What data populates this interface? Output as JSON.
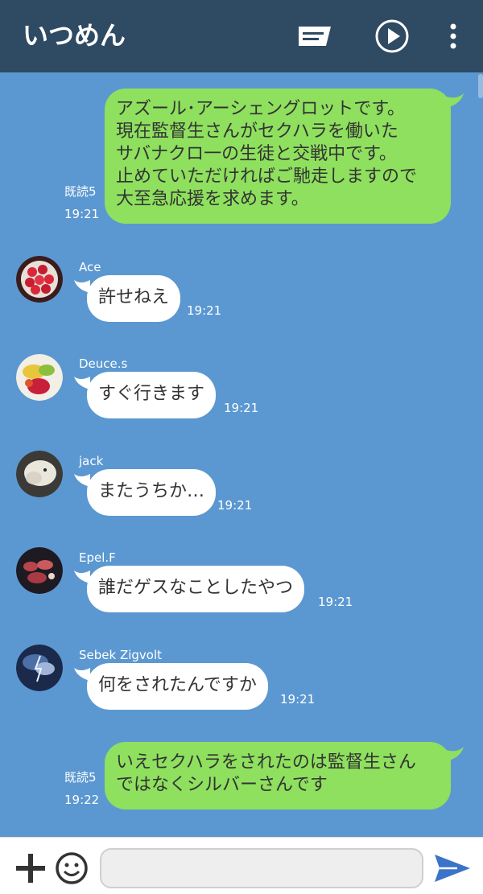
{
  "header": {
    "title": "いつめん",
    "icons": [
      "note-icon",
      "play-icon",
      "more-vert-icon"
    ],
    "colors": {
      "bar": "#2f4a63",
      "background": "#5b98d1",
      "outgoing": "#8ee05e",
      "incoming": "#ffffff"
    }
  },
  "messages": [
    {
      "direction": "out",
      "lines": [
        "アズール･アーシェングロットです。",
        "現在監督生さんがセクハラを働いた",
        "サバナクロ一の生徒と交戦中です。",
        "止めていただければご馳走しますので",
        "大至急応援を求めます。"
      ],
      "read": "既読5",
      "time": "19:21"
    },
    {
      "direction": "in",
      "sender": "Ace",
      "text": "許せねえ",
      "time": "19:21",
      "avatar_icon": "strawberry-tart-avatar"
    },
    {
      "direction": "in",
      "sender": "Deuce.s",
      "text": "すぐ行きます",
      "time": "19:21",
      "avatar_icon": "fruit-avatar"
    },
    {
      "direction": "in",
      "sender": "jack",
      "text": "またうちか…",
      "time": "19:21",
      "avatar_icon": "dog-avatar"
    },
    {
      "direction": "in",
      "sender": "Epel.F",
      "text": "誰だゲスなことしたやつ",
      "time": "19:21",
      "avatar_icon": "meat-avatar"
    },
    {
      "direction": "in",
      "sender": "Sebek Zigvolt",
      "text": "何をされたんですか",
      "time": "19:21",
      "avatar_icon": "storm-avatar"
    },
    {
      "direction": "out",
      "lines": [
        "いえセクハラをされたのは監督生さん",
        "ではなくシルバーさんです"
      ],
      "read": "既読5",
      "time": "19:22"
    }
  ],
  "composer": {
    "value": "",
    "icons": [
      "plus-icon",
      "emoji-icon",
      "send-icon"
    ]
  }
}
